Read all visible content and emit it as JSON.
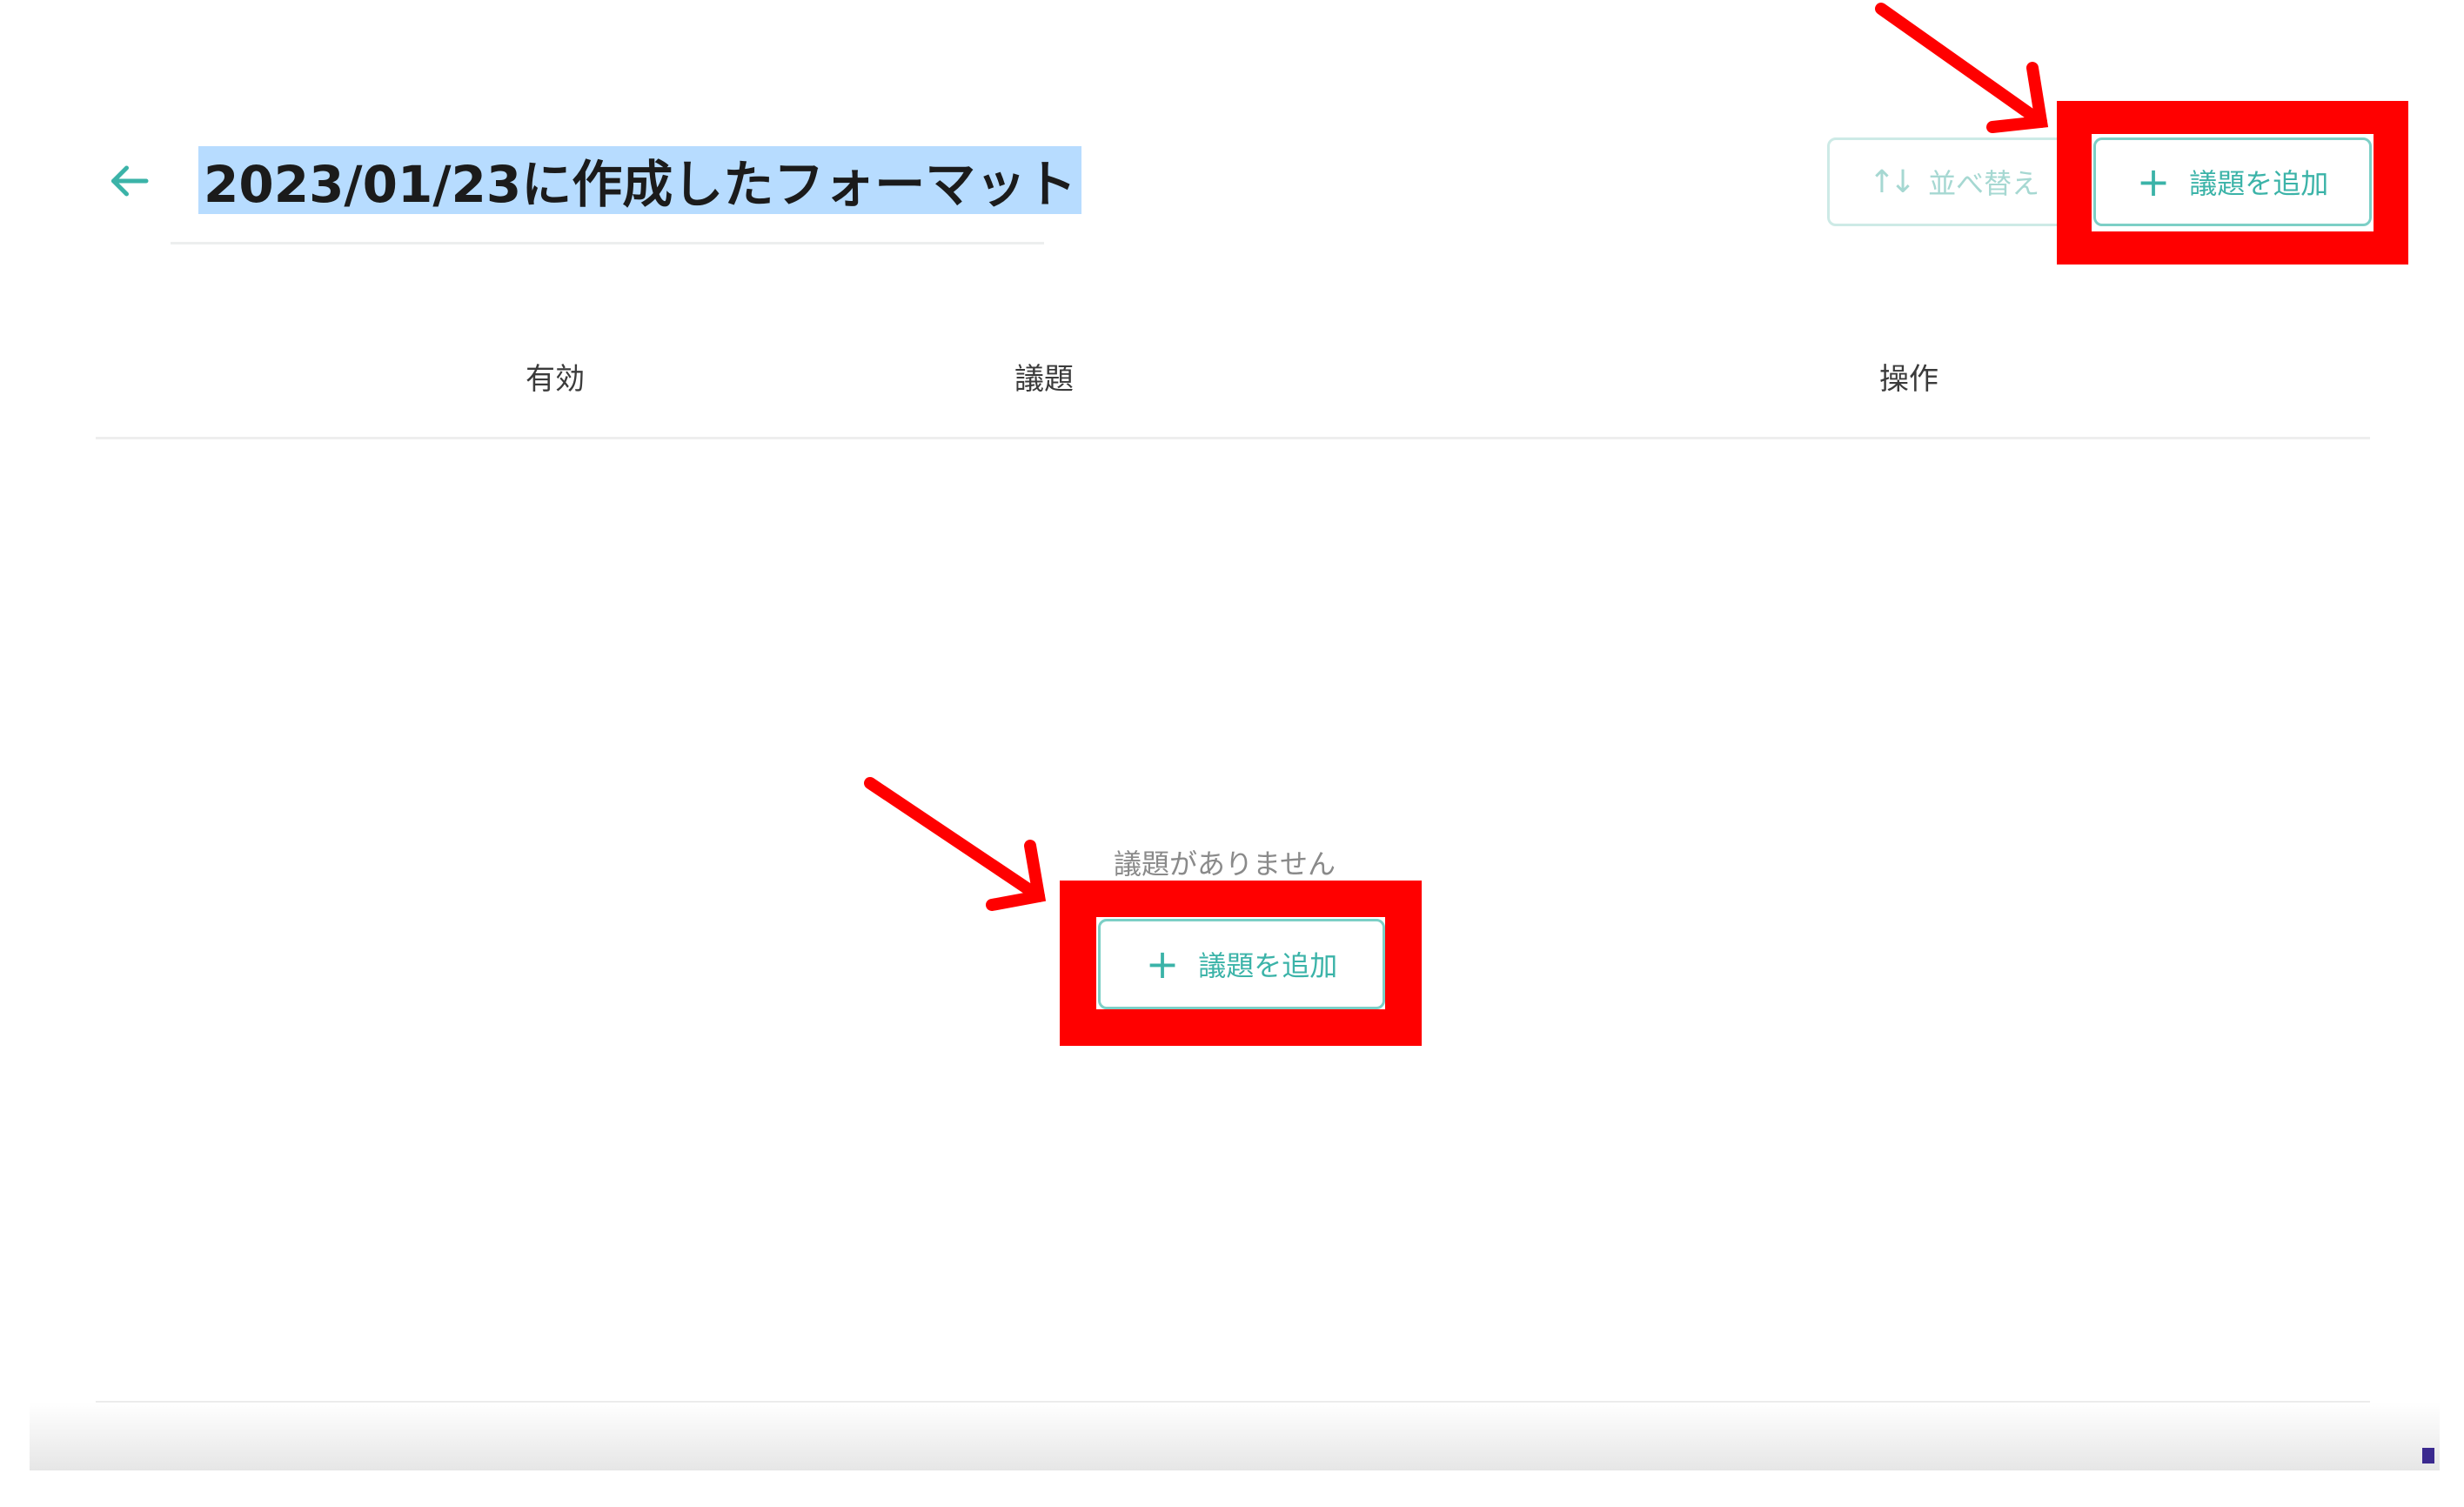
{
  "header": {
    "title": "2023/01/23に作成したフォーマット",
    "sort_label": "並べ替え",
    "add_agenda_label": "議題を追加"
  },
  "table": {
    "columns": [
      "有効",
      "議題",
      "操作"
    ]
  },
  "empty_state": {
    "message": "議題がありません",
    "add_agenda_label": "議題を追加"
  },
  "colors": {
    "accent": "#3bb3a8",
    "accent_border": "#7ccfc6",
    "title_highlight": "#b7dcff",
    "annotation_red": "#ff0000"
  },
  "icons": {
    "back": "arrow-left-icon",
    "sort": "sort-arrows-icon",
    "add": "plus-icon"
  }
}
